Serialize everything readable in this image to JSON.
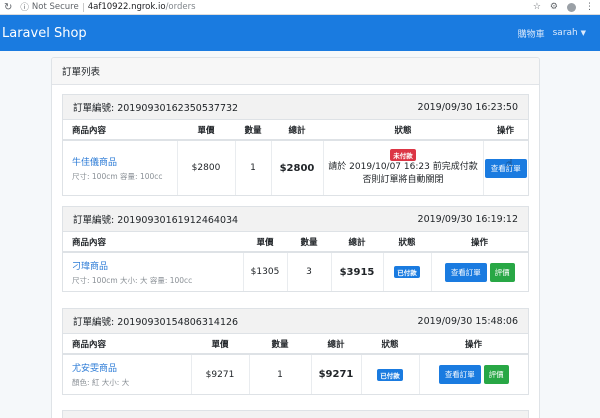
{
  "browser": {
    "security_label": "Not Secure",
    "url_host": "4af10922.ngrok.io",
    "url_path": "/orders"
  },
  "navbar": {
    "brand": "Laravel Shop",
    "cart_label": "購物車",
    "user_name": "sarah"
  },
  "page": {
    "title": "訂單列表"
  },
  "orders": [
    {
      "number_label": "訂單編號: 20190930162350537732",
      "time": "2019/09/30 16:23:50",
      "headers": [
        "商品內容",
        "單價",
        "數量",
        "總計",
        "狀態",
        "操作"
      ],
      "product_name": "牛佳儀商品",
      "product_meta": "尺寸: 100cm   容量: 100cc",
      "price": "$2800",
      "qty": "1",
      "total": "$2800",
      "status_badge": "未付款",
      "status_note_1": "請於 2019/10/07 16:23 前完成付款",
      "status_note_2": "否則訂單將自動關閉",
      "view_button": "查看訂單"
    },
    {
      "number_label": "訂單編號: 20190930161912464034",
      "time": "2019/09/30 16:19:12",
      "headers": [
        "商品內容",
        "單價",
        "數量",
        "總計",
        "狀態",
        "操作"
      ],
      "product_name": "刁瑋商品",
      "product_meta": "尺寸: 100cm   大小: 大   容量: 100cc",
      "price": "$1305",
      "qty": "3",
      "total": "$3915",
      "status_badge": "已付款",
      "view_button": "查看訂單",
      "review_button": "評價"
    },
    {
      "number_label": "訂單編號: 20190930154806314126",
      "time": "2019/09/30 15:48:06",
      "headers": [
        "商品內容",
        "單價",
        "數量",
        "總計",
        "狀態",
        "操作"
      ],
      "product_name": "尤安雯商品",
      "product_meta": "顏色: 紅   大小: 大",
      "price": "$9271",
      "qty": "1",
      "total": "$9271",
      "status_badge": "已付款",
      "view_button": "查看訂單",
      "review_button": "評價"
    }
  ],
  "colors": {
    "navbar": "#1a7be0",
    "unpaid": "#dc3545",
    "paid": "#1a7be0",
    "review": "#28a745"
  }
}
